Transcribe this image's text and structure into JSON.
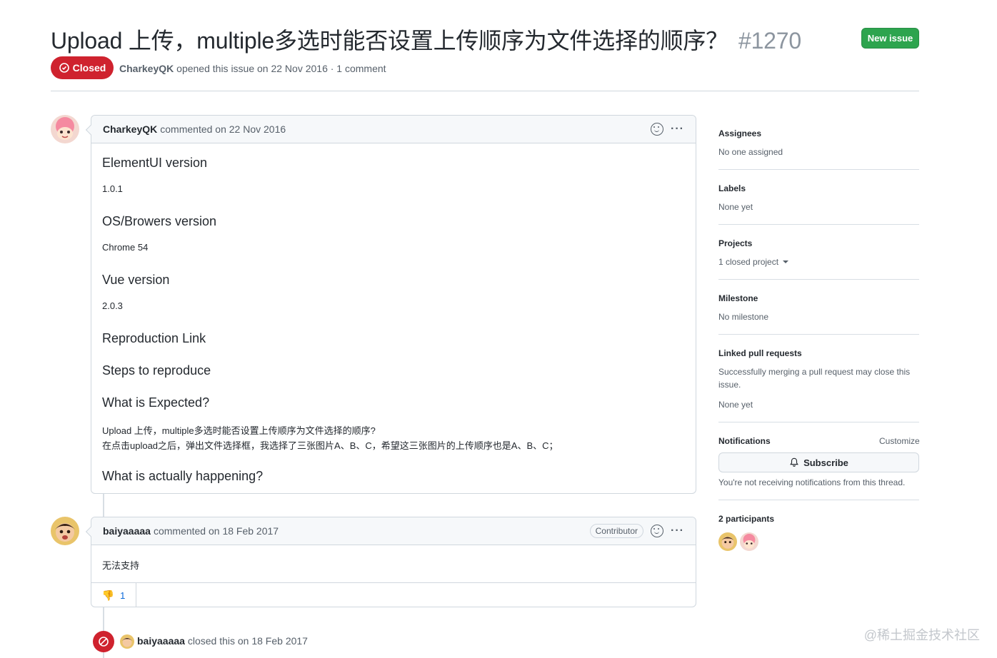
{
  "header": {
    "title": "Upload 上传，multiple多选时能否设置上传顺序为文件选择的顺序？",
    "number": "#1270",
    "new_issue_label": "New issue",
    "state_label": "Closed",
    "author": "CharkeyQK",
    "meta_text": "opened this issue on 22 Nov 2016 · 1 comment"
  },
  "comment1": {
    "author": "CharkeyQK",
    "meta": "commented on 22 Nov 2016",
    "h_elementui": "ElementUI version",
    "v_elementui": "1.0.1",
    "h_os": "OS/Browers version",
    "v_os": "Chrome 54",
    "h_vue": "Vue version",
    "v_vue": "2.0.3",
    "h_repro": "Reproduction Link",
    "h_steps": "Steps to reproduce",
    "h_expected": "What is Expected?",
    "expected_line1": "Upload 上传，multiple多选时能否设置上传顺序为文件选择的顺序?",
    "expected_line2": "在点击upload之后，弹出文件选择框，我选择了三张图片A、B、C，希望这三张图片的上传顺序也是A、B、C；",
    "h_actual": "What is actually happening?"
  },
  "comment2": {
    "author": "baiyaaaaa",
    "meta": "commented on 18 Feb 2017",
    "badge": "Contributor",
    "body": "无法支持",
    "reaction_count": "1"
  },
  "event": {
    "actor": "baiyaaaaa",
    "text": "closed this on 18 Feb 2017"
  },
  "sidebar": {
    "assignees_h": "Assignees",
    "assignees_v": "No one assigned",
    "labels_h": "Labels",
    "labels_v": "None yet",
    "projects_h": "Projects",
    "projects_v": "1 closed project",
    "milestone_h": "Milestone",
    "milestone_v": "No milestone",
    "linked_h": "Linked pull requests",
    "linked_desc1": "Successfully merging a pull request may close this",
    "linked_desc2": "issue.",
    "linked_v": "None yet",
    "notifications_h": "Notifications",
    "customize": "Customize",
    "subscribe": "Subscribe",
    "notif_text": "You're not receiving notifications from this thread.",
    "participants_h": "2 participants"
  },
  "watermark": "@稀土掘金技术社区",
  "colors": {
    "closed": "#cf222e",
    "new_issue": "#2da44e"
  }
}
